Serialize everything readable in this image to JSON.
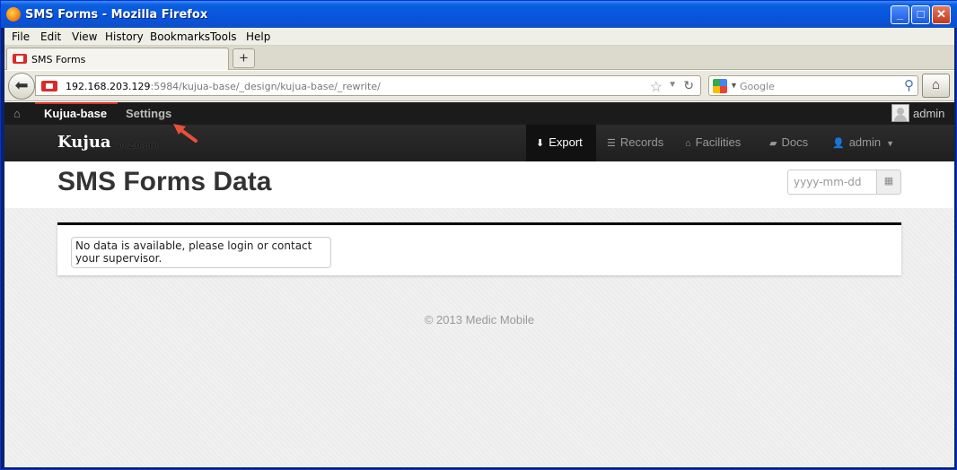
{
  "window": {
    "title": "SMS Forms - Mozilla Firefox"
  },
  "menu": [
    "File",
    "Edit",
    "View",
    "History",
    "Bookmarks",
    "Tools",
    "Help"
  ],
  "tab": {
    "label": "SMS Forms"
  },
  "address": {
    "host": "192.168.203.129",
    "path": ":5984/kujua-base/_design/kujua-base/_rewrite/"
  },
  "search": {
    "placeholder": "Google"
  },
  "topbar": {
    "db_name": "Kujua-base",
    "settings": "Settings",
    "user": "admin"
  },
  "app": {
    "brand": "Kujua",
    "version": "v0.2.0-pre"
  },
  "nav": [
    {
      "label": "Export",
      "icon": "download-icon",
      "active": true
    },
    {
      "label": "Records",
      "icon": "list-icon"
    },
    {
      "label": "Facilities",
      "icon": "home-icon"
    },
    {
      "label": "Docs",
      "icon": "book-icon"
    },
    {
      "label": "admin",
      "icon": "user-icon"
    }
  ],
  "header": {
    "title": "SMS Forms Data",
    "date_placeholder": "yyyy-mm-dd"
  },
  "content": {
    "message": "No data is available, please login or contact your supervisor."
  },
  "footer": {
    "text": "© 2013 Medic Mobile"
  },
  "colors": {
    "accent": "#d9332a",
    "navbar": "#1f1f1f",
    "title_bar": "#0854dc"
  }
}
